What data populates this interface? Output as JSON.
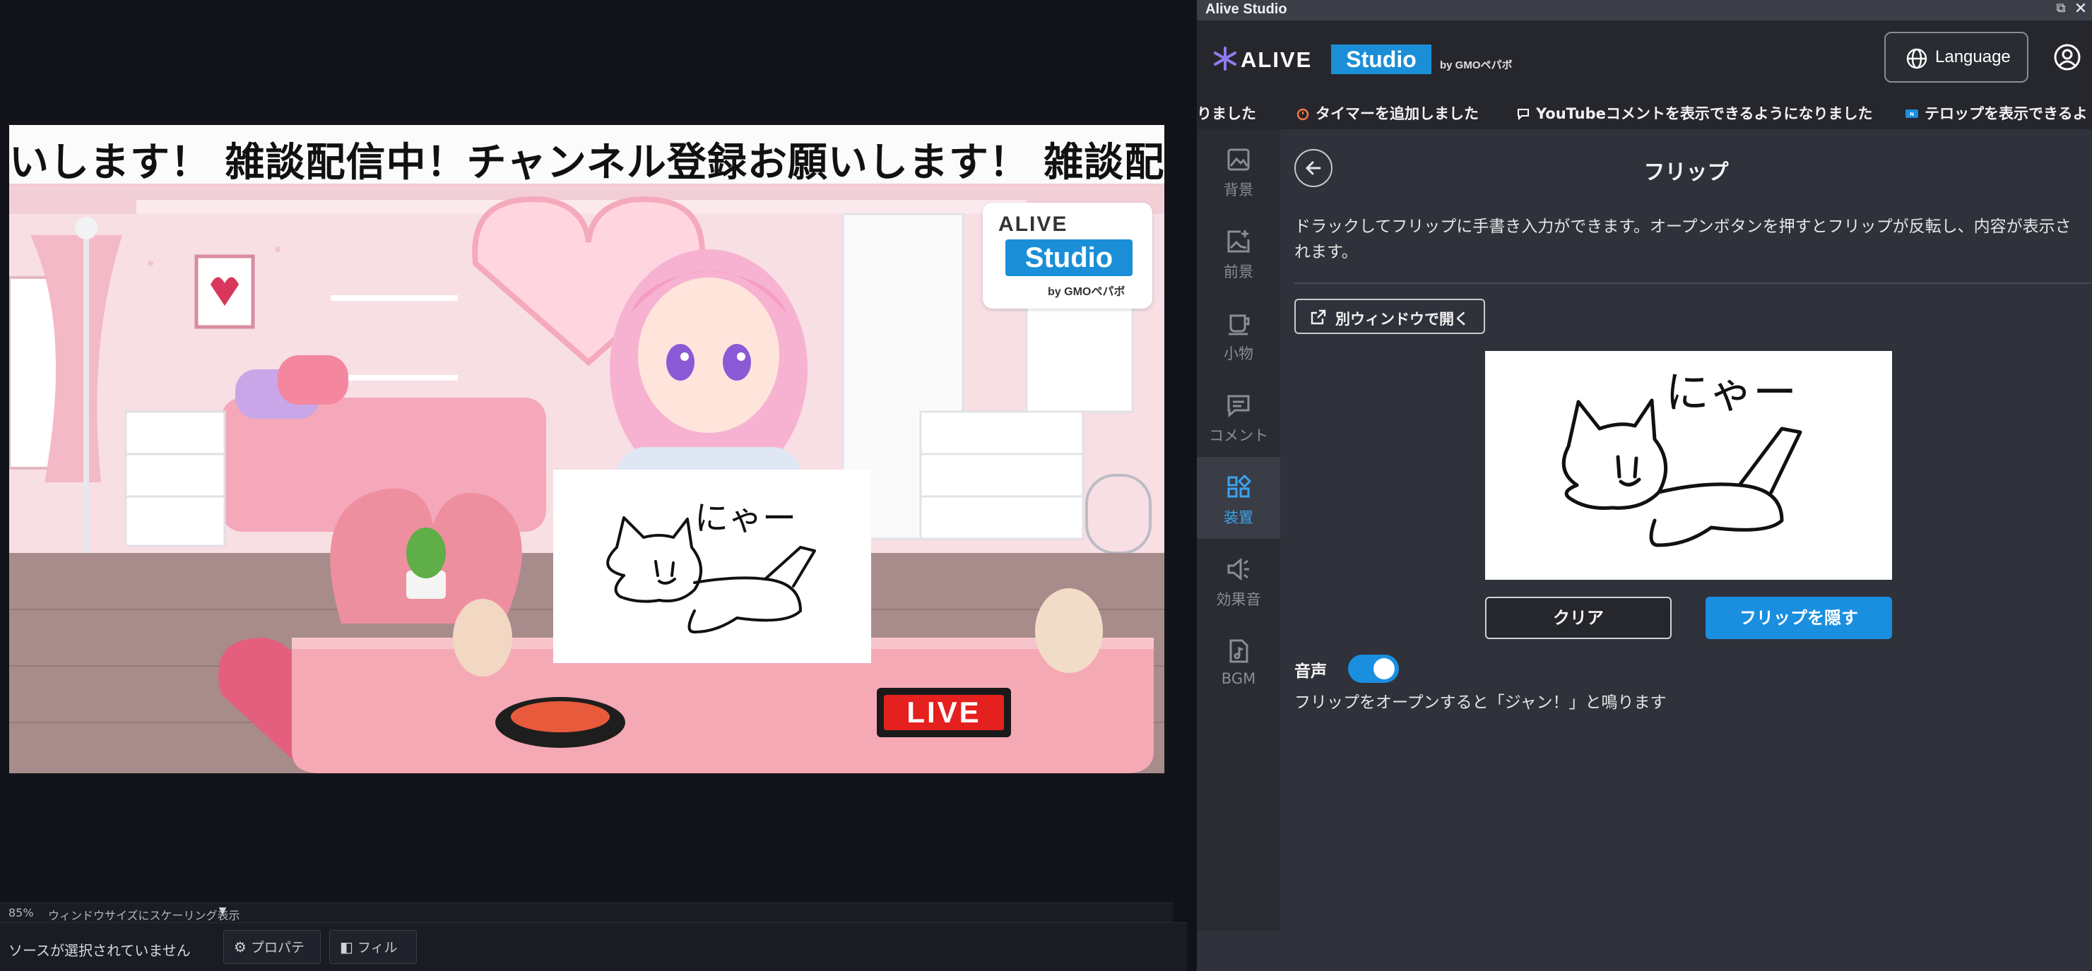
{
  "preview": {
    "ticker_text": "いします！ 雑談配信中！チャンネル登録お願いします！ 雑談配信中！",
    "scene_logo": {
      "top": "ALIVE",
      "studio": "Studio",
      "by": "by GMOペパボ"
    },
    "flip_text": "にゃー",
    "live_sign": "LIVE"
  },
  "obs": {
    "zoom_percent": "85%",
    "zoom_mode": "ウィンドウサイズにスケーリング表示",
    "no_source": "ソースが選択されていません",
    "properties_label": "プロパティ",
    "filter_label": "フィルタ"
  },
  "window": {
    "title": "Alive Studio"
  },
  "header": {
    "brand_alive": "ALIVE",
    "brand_studio": "Studio",
    "brand_by": "by GMOペパボ",
    "language_label": "Language"
  },
  "news": [
    {
      "text": "りました",
      "icon": ""
    },
    {
      "text": "タイマーを追加しました",
      "icon": "alarm-icon"
    },
    {
      "text": "YouTubeコメントを表示できるようになりました",
      "icon": "comment-icon"
    },
    {
      "text": "テロップを表示できるよ",
      "icon": "new-badge-icon"
    }
  ],
  "sidebar": {
    "items": [
      {
        "label": "背景",
        "icon": "image-icon"
      },
      {
        "label": "前景",
        "icon": "add-image-icon"
      },
      {
        "label": "小物",
        "icon": "cup-icon"
      },
      {
        "label": "コメント",
        "icon": "comment-icon"
      },
      {
        "label": "装置",
        "icon": "widgets-icon"
      },
      {
        "label": "効果音",
        "icon": "speaker-icon"
      },
      {
        "label": "BGM",
        "icon": "music-file-icon"
      }
    ],
    "active_index": 4
  },
  "flip_page": {
    "title": "フリップ",
    "description": "ドラックしてフリップに手書き入力ができます。オープンボタンを押すとフリップが反転し、内容が表示されます。",
    "open_window_label": "別ウィンドウで開く",
    "canvas_text": "にゃー",
    "clear_label": "クリア",
    "hide_label": "フリップを隠す",
    "sound_label": "音声",
    "sound_enabled": true,
    "sound_note": "フリップをオープンすると「ジャン！」と鳴ります"
  },
  "colors": {
    "accent": "#1a8fe0",
    "panel_bg": "#2f323a",
    "header_bg": "#25272d",
    "active_text": "#3aa3ee",
    "live_red": "#e4211f"
  }
}
